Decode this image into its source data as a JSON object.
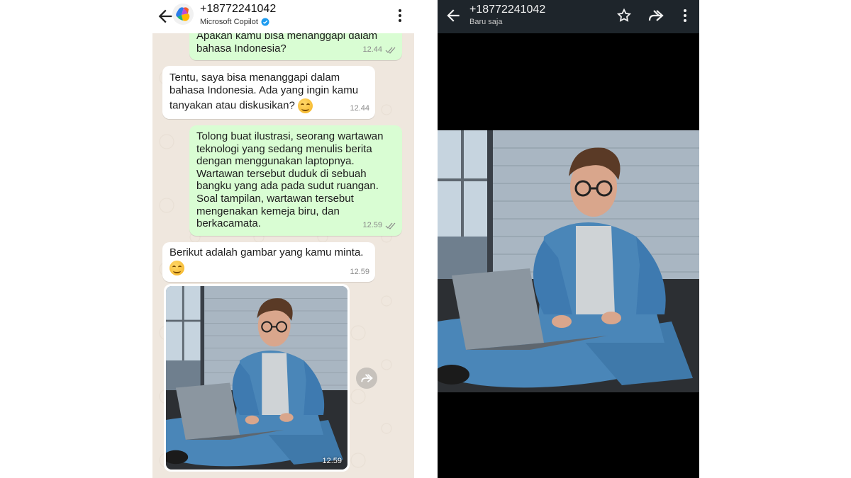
{
  "chat": {
    "header": {
      "contact_number": "+18772241042",
      "contact_subtitle": "Microsoft Copilot"
    },
    "messages": [
      {
        "direction": "out",
        "lines": [
          "Apakan kamu bisa menanggapi dalam",
          "bahasa Indonesia?"
        ],
        "time": "12.44"
      },
      {
        "direction": "in",
        "lines": [
          "Tentu, saya bisa menanggapi dalam",
          "bahasa Indonesia. Ada yang ingin kamu",
          "tanyakan atau diskusikan?"
        ],
        "time": "12.44"
      },
      {
        "direction": "out",
        "lines": [
          "Tolong buat ilustrasi, seorang wartawan",
          "teknologi yang sedang menulis berita",
          "dengan menggunakan laptopnya.",
          "Wartawan tersebut duduk di sebuah",
          "bangku yang ada pada sudut ruangan.",
          "Soal tampilan, wartawan tersebut",
          "mengenakan kemeja biru, dan",
          "berkacamata."
        ],
        "time": "12.59"
      },
      {
        "direction": "in",
        "lines": [
          "Berikut adalah gambar yang kamu minta."
        ],
        "time": "12.59"
      }
    ],
    "image_message": {
      "time": "12.59"
    }
  },
  "viewer": {
    "contact_number": "+18772241042",
    "subtitle": "Baru saja"
  },
  "colors": {
    "chat_bg": "#efe7de",
    "outgoing_bubble": "#d9fdd3",
    "incoming_bubble": "#ffffff",
    "verified_badge": "#1d9bf0",
    "viewer_header": "#1e252b"
  }
}
